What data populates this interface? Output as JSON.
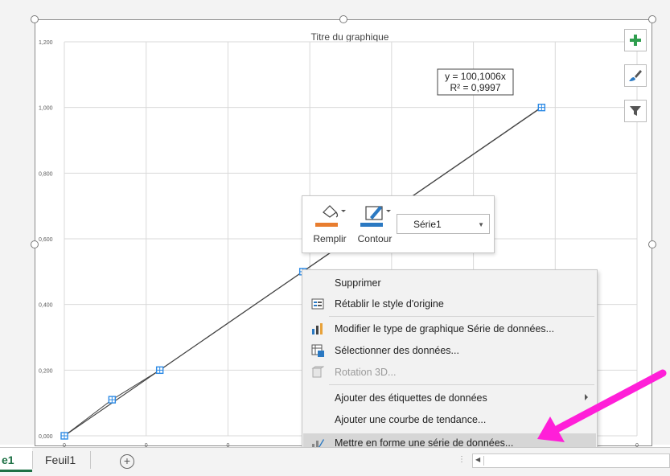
{
  "chart": {
    "title": "Titre du graphique",
    "trendline_eq": "y = 100,1006x",
    "trendline_r2": "R² = 0,9997",
    "y_ticks": [
      "0,000",
      "0,200",
      "0,400",
      "0,600",
      "0,800",
      "1,000",
      "1,200"
    ],
    "x_ticks": [
      "0",
      "0",
      "0",
      "0",
      "0",
      "0",
      "0",
      "0"
    ],
    "marker_color": "#2e8be5",
    "line_color": "#444444"
  },
  "chart_data": {
    "type": "scatter",
    "title": "Titre du graphique",
    "xlabel": "",
    "ylabel": "",
    "ylim": [
      0,
      1.2
    ],
    "xlim": [
      0,
      0.012
    ],
    "grid": true,
    "series": [
      {
        "x": [
          0,
          0.001,
          0.002,
          0.005,
          0.01
        ],
        "y": [
          0,
          0.11,
          0.2,
          0.5,
          1.0
        ]
      }
    ],
    "trendline": {
      "type": "linear",
      "label": "y = 100,1006x",
      "r2_label": "R² = 0,9997"
    }
  },
  "side_buttons": [
    {
      "icon": "plus-icon",
      "color": "#2f9e4f"
    },
    {
      "icon": "paintbrush-icon",
      "color": "#2b79c2"
    },
    {
      "icon": "filter-icon",
      "color": "#555555"
    }
  ],
  "minibar": {
    "fill_label": "Remplir",
    "outline_label": "Contour",
    "fill_color": "#e87d2f",
    "outline_color": "#2b79c2",
    "series_select": "Série1"
  },
  "context_menu": {
    "items": [
      {
        "label": "Supprimer",
        "icon": "",
        "disabled": false
      },
      {
        "label": "Rétablir le style d'origine",
        "icon": "reset-style-icon",
        "disabled": false
      },
      {
        "label": "Modifier le type de graphique Série de données...",
        "icon": "chart-type-icon",
        "disabled": false
      },
      {
        "label": "Sélectionner des données...",
        "icon": "select-data-icon",
        "disabled": false
      },
      {
        "label": "Rotation 3D...",
        "icon": "rotation-3d-icon",
        "disabled": true
      },
      {
        "label": "Ajouter des étiquettes de données",
        "icon": "",
        "disabled": false,
        "submenu": true
      },
      {
        "label": "Ajouter une courbe de tendance...",
        "icon": "",
        "disabled": false
      },
      {
        "label": "Mettre en forme une série de données...",
        "icon": "format-series-icon",
        "disabled": false,
        "highlighted": true
      }
    ]
  },
  "annotation": {
    "arrow_color": "#ff1fd8"
  },
  "sheet_tabs": [
    {
      "label": "e1",
      "active": true
    },
    {
      "label": "Feuil1",
      "active": false
    }
  ],
  "add_sheet": "+"
}
